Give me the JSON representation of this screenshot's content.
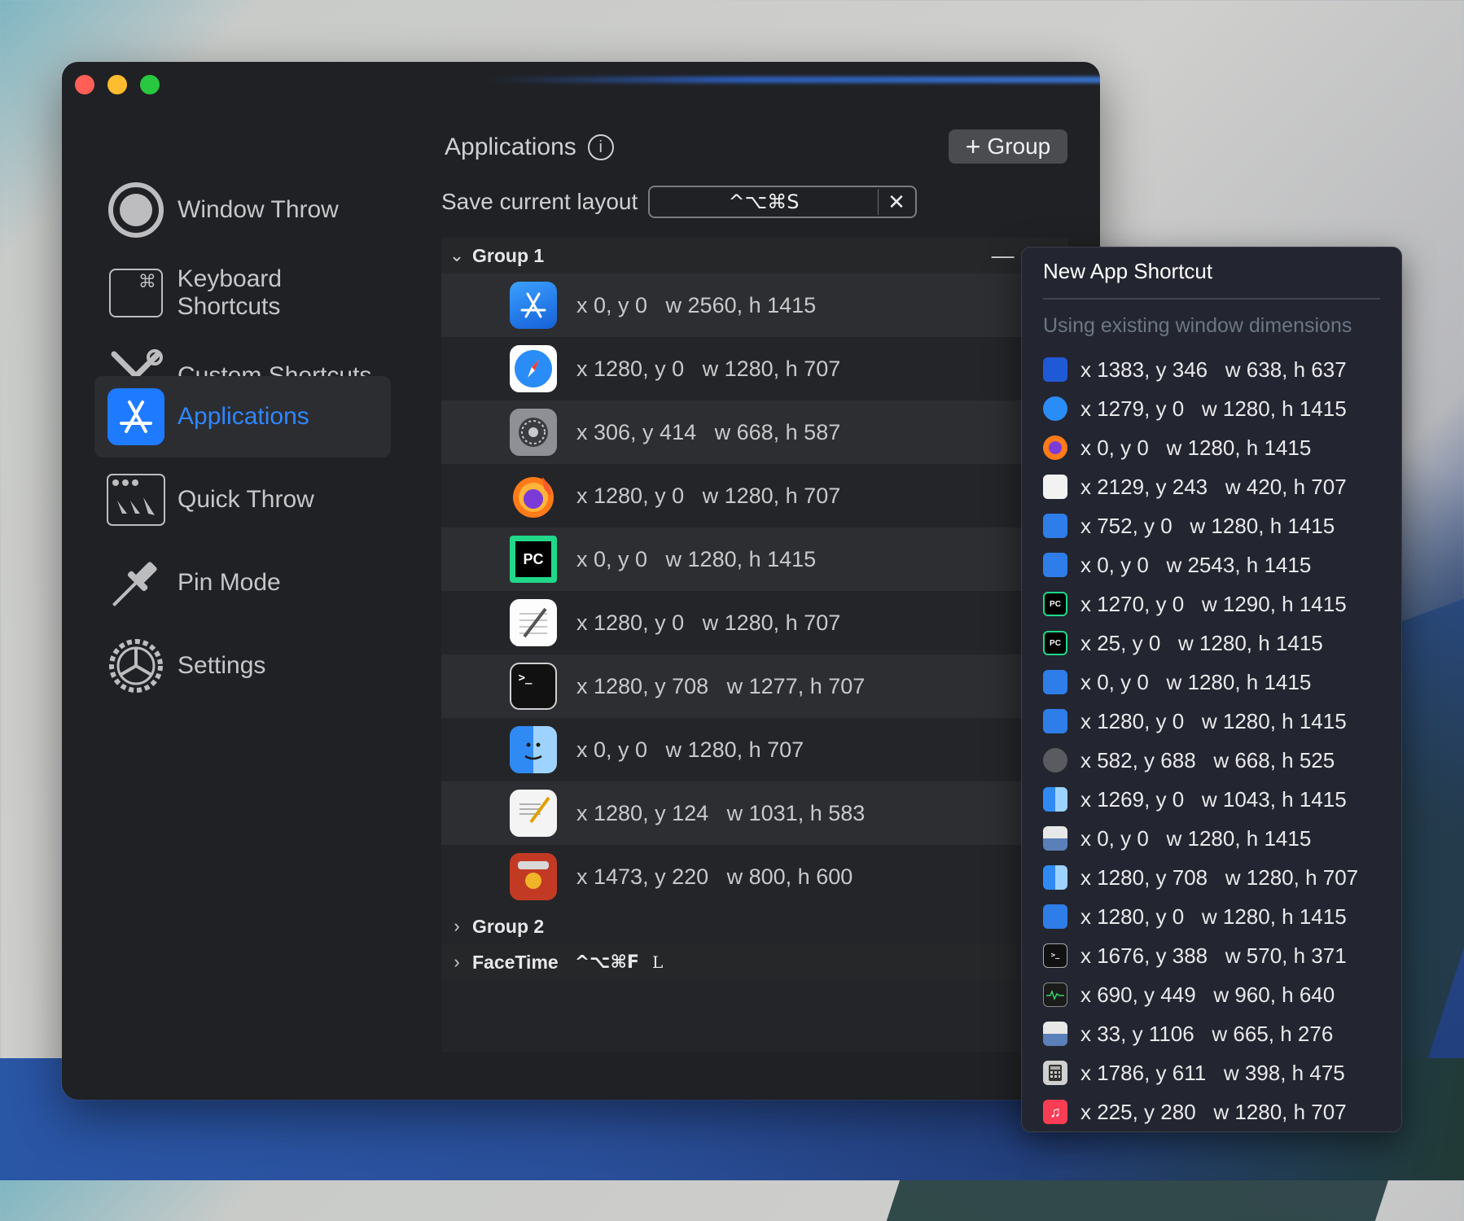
{
  "sidebar": {
    "items": [
      {
        "label": "Window Throw",
        "icon": "circle-target-icon"
      },
      {
        "label": "Keyboard Shortcuts",
        "icon": "command-key-icon",
        "glyph": "⌘"
      },
      {
        "label": "Custom Shortcuts",
        "icon": "tools-icon"
      },
      {
        "label": "Applications",
        "icon": "app-store-icon",
        "active": true
      },
      {
        "label": "Quick Throw",
        "icon": "quick-throw-icon"
      },
      {
        "label": "Pin Mode",
        "icon": "pin-icon"
      },
      {
        "label": "Settings",
        "icon": "gear-icon"
      }
    ]
  },
  "main": {
    "title": "Applications",
    "info_glyph": "i",
    "group_button": "Group",
    "group_button_glyph": "+",
    "save_layout_label": "Save current layout",
    "save_layout_shortcut": "^⌥⌘S",
    "clear_glyph": "✕"
  },
  "groups": [
    {
      "name": "Group 1",
      "expanded": true,
      "remove_glyph": "—",
      "add_glyph": "+",
      "rows": [
        {
          "app": "xcode",
          "dims": "x 0, y 0   w 2560, h 1415"
        },
        {
          "app": "safari",
          "dims": "x 1280, y 0   w 1280, h 707"
        },
        {
          "app": "system-settings",
          "dims": "x 306, y 414   w 668, h 587"
        },
        {
          "app": "firefox",
          "dims": "x 1280, y 0   w 1280, h 707"
        },
        {
          "app": "pycharm",
          "dims": "x 0, y 0   w 1280, h 1415",
          "badge": "PC"
        },
        {
          "app": "textedit",
          "dims": "x 1280, y 0   w 1280, h 707"
        },
        {
          "app": "terminal",
          "dims": "x 1280, y 708   w 1277, h 707",
          "badge": ">_"
        },
        {
          "app": "finder",
          "dims": "x 0, y 0   w 1280, h 707"
        },
        {
          "app": "plist-editor",
          "dims": "x 1280, y 124   w 1031, h 583"
        },
        {
          "app": "paprika",
          "dims": "x 1473, y 220   w 800, h 600"
        }
      ]
    },
    {
      "name": "Group 2",
      "expanded": false
    },
    {
      "name": "FaceTime",
      "expanded": false,
      "shortcut": "^⌥⌘F",
      "extra": "L"
    }
  ],
  "popup": {
    "title": "New App Shortcut",
    "subtitle": "Using existing window dimensions",
    "items": [
      {
        "app": "notes-blue",
        "dims": "x 1383, y 346   w 638, h 637"
      },
      {
        "app": "safari",
        "dims": "x 1279, y 0   w 1280, h 1415"
      },
      {
        "app": "firefox",
        "dims": "x 0, y 0   w 1280, h 1415"
      },
      {
        "app": "textedit",
        "dims": "x 2129, y 243   w 420, h 707"
      },
      {
        "app": "xcode",
        "dims": "x 752, y 0   w 1280, h 1415"
      },
      {
        "app": "xcode",
        "dims": "x 0, y 0   w 2543, h 1415"
      },
      {
        "app": "pycharm",
        "dims": "x 1270, y 0   w 1290, h 1415",
        "badge": "PC"
      },
      {
        "app": "pycharm",
        "dims": "x 25, y 0   w 1280, h 1415",
        "badge": "PC"
      },
      {
        "app": "xcode",
        "dims": "x 0, y 0   w 1280, h 1415"
      },
      {
        "app": "xcode",
        "dims": "x 1280, y 0   w 1280, h 1415"
      },
      {
        "app": "system-settings",
        "dims": "x 582, y 688   w 668, h 525"
      },
      {
        "app": "finder",
        "dims": "x 1269, y 0   w 1043, h 1415"
      },
      {
        "app": "disk-utility",
        "dims": "x 0, y 0   w 1280, h 1415"
      },
      {
        "app": "finder",
        "dims": "x 1280, y 708   w 1280, h 707"
      },
      {
        "app": "xcode",
        "dims": "x 1280, y 0   w 1280, h 1415"
      },
      {
        "app": "terminal",
        "dims": "x 1676, y 388   w 570, h 371",
        "badge": ">_"
      },
      {
        "app": "activity-monitor",
        "dims": "x 690, y 449   w 960, h 640"
      },
      {
        "app": "disk-utility",
        "dims": "x 33, y 1106   w 665, h 276"
      },
      {
        "app": "calculator",
        "dims": "x 1786, y 611   w 398, h 475"
      },
      {
        "app": "music",
        "dims": "x 225, y 280   w 1280, h 707",
        "badge": "♫"
      }
    ]
  },
  "colors": {
    "accent": "#2f86ff",
    "window_bg": "#202124",
    "row_alt": "#2d2e31"
  }
}
